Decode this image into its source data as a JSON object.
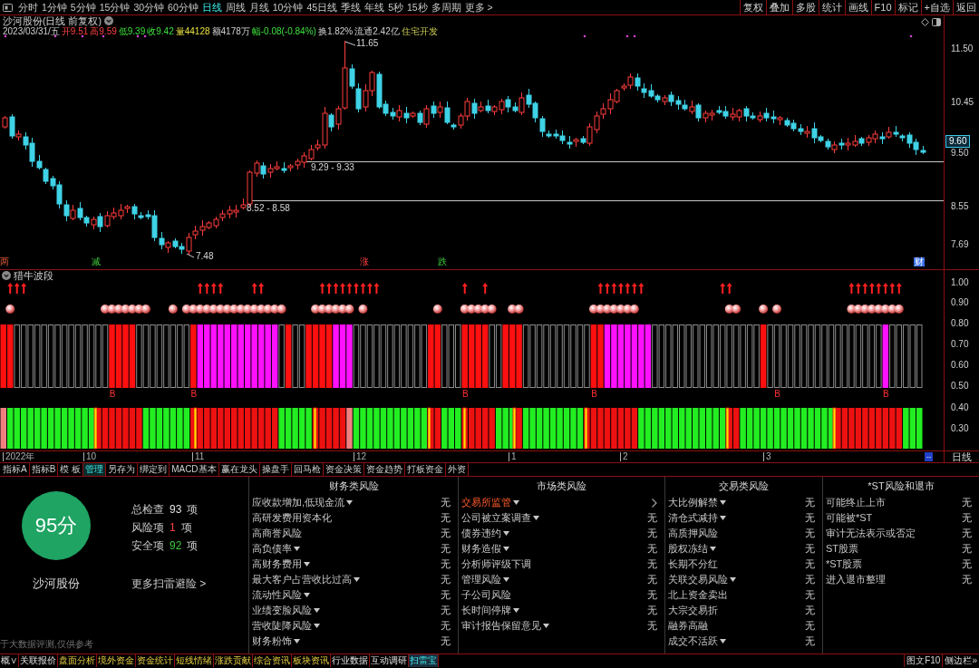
{
  "toolbar": {
    "periods": [
      {
        "label": "分时",
        "selected": false
      },
      {
        "label": "1分钟",
        "selected": false
      },
      {
        "label": "5分钟",
        "selected": false
      },
      {
        "label": "15分钟",
        "selected": false
      },
      {
        "label": "30分钟",
        "selected": false
      },
      {
        "label": "60分钟",
        "selected": false
      },
      {
        "label": "日线",
        "selected": true
      },
      {
        "label": "周线",
        "selected": false
      },
      {
        "label": "月线",
        "selected": false
      },
      {
        "label": "10分钟",
        "selected": false
      },
      {
        "label": "45日线",
        "selected": false
      },
      {
        "label": "季线",
        "selected": false
      },
      {
        "label": "年线",
        "selected": false
      },
      {
        "label": "5秒",
        "selected": false
      },
      {
        "label": "15秒",
        "selected": false
      },
      {
        "label": "多周期",
        "selected": false
      },
      {
        "label": "更多 >",
        "selected": false
      }
    ],
    "actions": [
      "复权",
      "叠加",
      "多股",
      "统计",
      "画线",
      "F10",
      "标记",
      "+自选",
      "返回"
    ]
  },
  "price_chart": {
    "title": "沙河股份(日线 前复权)",
    "quote": [
      {
        "text": "2023/03/31/五",
        "kind": "plain"
      },
      {
        "text": "开9.51",
        "kind": "up"
      },
      {
        "text": "高9.59",
        "kind": "up"
      },
      {
        "text": "低9.39",
        "kind": "down"
      },
      {
        "text": "收9.42",
        "kind": "down"
      },
      {
        "text": "量44128",
        "kind": "volume"
      },
      {
        "text": "额4178万",
        "kind": "plain"
      },
      {
        "text": "幅-0.08(-0.84%)",
        "kind": "down"
      },
      {
        "text": "换1.82%",
        "kind": "plain"
      },
      {
        "text": "流通2.42亿",
        "kind": "plain"
      },
      {
        "text": "住宅开发",
        "kind": "sector"
      }
    ],
    "axis_labels": [
      "11.50",
      "10.45",
      "9.50",
      "8.55",
      "7.69"
    ],
    "current_price": "9.60",
    "annotations": [
      "11.65",
      "9.29 - 9.33",
      "8.52 - 8.58",
      "7.48"
    ],
    "events": [
      {
        "text": "两",
        "kind": "warn"
      },
      {
        "text": "减",
        "kind": "down"
      },
      {
        "text": "涨",
        "kind": "up"
      },
      {
        "text": "跌",
        "kind": "down"
      },
      {
        "text": "财",
        "kind": "notice"
      }
    ]
  },
  "indicator": {
    "title": "猎牛波段",
    "axis_labels": [
      "1.00",
      "0.90",
      "0.80",
      "0.70",
      "0.60",
      "0.50",
      "0.40",
      "0.30"
    ],
    "signals": [
      "B",
      "B",
      "B",
      "B",
      "B",
      "B"
    ]
  },
  "time_axis": {
    "labels": [
      "2022年",
      "10",
      "11",
      "12",
      "1",
      "2",
      "3"
    ],
    "button": "--",
    "period": "日线"
  },
  "indicator_tabs": [
    {
      "label": "指标A",
      "selected": false
    },
    {
      "label": "指标B",
      "selected": false
    },
    {
      "label": "模 板",
      "selected": false
    },
    {
      "label": "管理",
      "selected": true
    },
    {
      "label": "另存为",
      "selected": false
    },
    {
      "label": "绑定到",
      "selected": false
    },
    {
      "label": "MACD基本",
      "selected": false
    },
    {
      "label": "赢在龙头",
      "selected": false
    },
    {
      "label": "操盘手",
      "selected": false
    },
    {
      "label": "回马枪",
      "selected": false
    },
    {
      "label": "资金决策",
      "selected": false
    },
    {
      "label": "资金趋势",
      "selected": false
    },
    {
      "label": "打板资金",
      "selected": false
    },
    {
      "label": "外资",
      "selected": false
    }
  ],
  "risk_scan": {
    "score": "95分",
    "stock": "沙河股份",
    "stats": [
      {
        "label": "总检查",
        "value": "93",
        "unit": "项",
        "kind": "total"
      },
      {
        "label": "风险项",
        "value": "1",
        "unit": "项",
        "kind": "risk"
      },
      {
        "label": "安全项",
        "value": "92",
        "unit": "项",
        "kind": "safe"
      }
    ],
    "more_link": "更多扫雷避险 >",
    "note": "于大数据评测,仅供参考",
    "categories": [
      {
        "title": "财务类风险",
        "items": [
          {
            "name": "应收款增加,低现金流",
            "dropdown": true,
            "flagged": false,
            "result": "无"
          },
          {
            "name": "高研发费用资本化",
            "dropdown": false,
            "flagged": false,
            "result": "无"
          },
          {
            "name": "高商誉风险",
            "dropdown": false,
            "flagged": false,
            "result": "无"
          },
          {
            "name": "高负债率",
            "dropdown": true,
            "flagged": false,
            "result": "无"
          },
          {
            "name": "高财务费用",
            "dropdown": true,
            "flagged": false,
            "result": "无"
          },
          {
            "name": "最大客户占营收比过高",
            "dropdown": true,
            "flagged": false,
            "result": "无"
          },
          {
            "name": "流动性风险",
            "dropdown": true,
            "flagged": false,
            "result": "无"
          },
          {
            "name": "业绩变脸风险",
            "dropdown": true,
            "flagged": false,
            "result": "无"
          },
          {
            "name": "营收陡降风险",
            "dropdown": true,
            "flagged": false,
            "result": "无"
          },
          {
            "name": "财务粉饰",
            "dropdown": true,
            "flagged": false,
            "result": "无"
          }
        ]
      },
      {
        "title": "市场类风险",
        "items": [
          {
            "name": "交易所监管",
            "dropdown": true,
            "flagged": true
          },
          {
            "name": "公司被立案调查",
            "dropdown": true,
            "flagged": false,
            "result": "无"
          },
          {
            "name": "债券违约",
            "dropdown": true,
            "flagged": false,
            "result": "无"
          },
          {
            "name": "财务造假",
            "dropdown": true,
            "flagged": false,
            "result": "无"
          },
          {
            "name": "分析师评级下调",
            "dropdown": false,
            "flagged": false,
            "result": "无"
          },
          {
            "name": "管理风险",
            "dropdown": true,
            "flagged": false,
            "result": "无"
          },
          {
            "name": "子公司风险",
            "dropdown": false,
            "flagged": false,
            "result": "无"
          },
          {
            "name": "长时间停牌",
            "dropdown": true,
            "flagged": false,
            "result": "无"
          },
          {
            "name": "审计报告保留意见",
            "dropdown": true,
            "flagged": false,
            "result": "无"
          }
        ]
      },
      {
        "title": "交易类风险",
        "items": [
          {
            "name": "大比例解禁",
            "dropdown": true,
            "flagged": false,
            "result": "无"
          },
          {
            "name": "清仓式减持",
            "dropdown": true,
            "flagged": false,
            "result": "无"
          },
          {
            "name": "高质押风险",
            "dropdown": false,
            "flagged": false,
            "result": "无"
          },
          {
            "name": "股权冻结",
            "dropdown": true,
            "flagged": false,
            "result": "无"
          },
          {
            "name": "长期不分红",
            "dropdown": false,
            "flagged": false,
            "result": "无"
          },
          {
            "name": "关联交易风险",
            "dropdown": true,
            "flagged": false,
            "result": "无"
          },
          {
            "name": "北上资金卖出",
            "dropdown": false,
            "flagged": false,
            "result": "无"
          },
          {
            "name": "大宗交易折",
            "dropdown": false,
            "flagged": false,
            "result": "无"
          },
          {
            "name": "融券高融",
            "dropdown": false,
            "flagged": false,
            "result": "无"
          },
          {
            "name": "成交不活跃",
            "dropdown": true,
            "flagged": false,
            "result": "无"
          }
        ]
      },
      {
        "title": "*ST风险和退市",
        "items": [
          {
            "name": "可能终止上市",
            "dropdown": false,
            "flagged": false,
            "result": "无"
          },
          {
            "name": "可能被*ST",
            "dropdown": false,
            "flagged": false,
            "result": "无"
          },
          {
            "name": "审计无法表示或否定",
            "dropdown": false,
            "flagged": false,
            "result": "无"
          },
          {
            "name": "ST股票",
            "dropdown": false,
            "flagged": false,
            "result": "无"
          },
          {
            "name": "*ST股票",
            "dropdown": false,
            "flagged": false,
            "result": "无"
          },
          {
            "name": "进入退市整理",
            "dropdown": false,
            "flagged": false,
            "result": "无"
          }
        ]
      }
    ]
  },
  "bottom_tabs": [
    {
      "label": "概∨",
      "kind": "quote",
      "selected": false
    },
    {
      "label": "关联报价",
      "kind": "quote",
      "selected": false
    },
    {
      "label": "盘面分析",
      "kind": "data",
      "selected": false
    },
    {
      "label": "境外资金",
      "kind": "data",
      "selected": false
    },
    {
      "label": "资金统计",
      "kind": "data",
      "selected": false
    },
    {
      "label": "短线情绪",
      "kind": "data",
      "selected": false
    },
    {
      "label": "涨跌贡献",
      "kind": "data",
      "selected": false
    },
    {
      "label": "综合资讯",
      "kind": "data",
      "selected": false
    },
    {
      "label": "板块资讯",
      "kind": "data",
      "selected": false
    },
    {
      "label": "行业数据",
      "kind": "quote",
      "selected": false
    },
    {
      "label": "互动调研",
      "kind": "quote",
      "selected": false
    },
    {
      "label": "扫雷宝",
      "kind": "tool",
      "selected": true
    }
  ],
  "side_buttons": [
    "图文F10",
    "侧边栏»"
  ]
}
